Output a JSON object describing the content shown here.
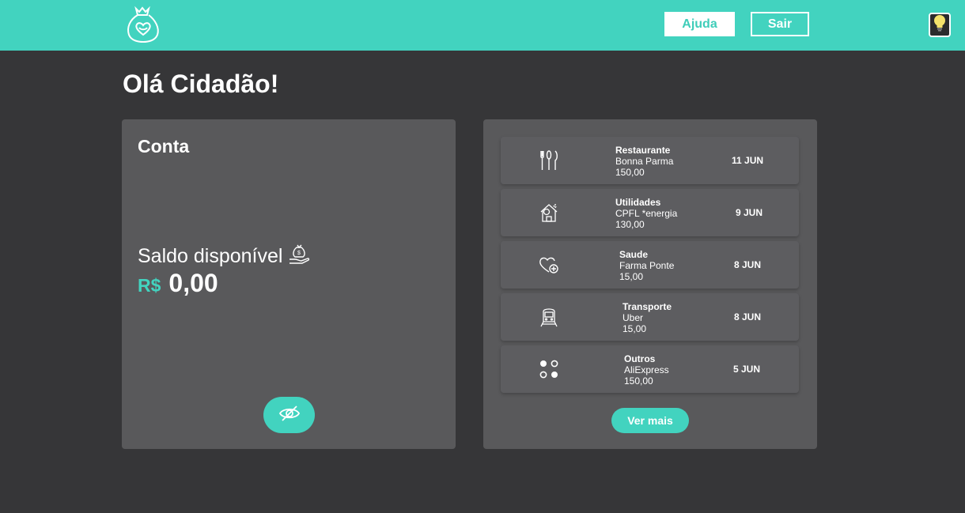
{
  "header": {
    "logo_icon": "money-bag-heart-icon",
    "help_label": "Ajuda",
    "logout_label": "Sair",
    "theme_icon": "lightbulb-icon",
    "accent_color": "#42d3bf"
  },
  "greeting": "Olá Cidadão!",
  "account": {
    "title": "Conta",
    "balance_label": "Saldo disponível",
    "balance_icon": "money-bag-hand-icon",
    "currency": "R$",
    "amount": "0,00",
    "toggle_icon": "eye-slash-icon"
  },
  "transactions": {
    "items": [
      {
        "category": "Restaurante",
        "merchant": "Bonna Parma",
        "value": "150,00",
        "date": "11 JUN",
        "icon": "cutlery-icon"
      },
      {
        "category": "Utilidades",
        "merchant": "CPFL *energia",
        "value": "130,00",
        "date": "9 JUN",
        "icon": "house-utilities-icon"
      },
      {
        "category": "Saude",
        "merchant": "Farma Ponte",
        "value": "15,00",
        "date": "8 JUN",
        "icon": "heart-health-icon"
      },
      {
        "category": "Transporte",
        "merchant": "Uber",
        "value": "15,00",
        "date": "8 JUN",
        "icon": "train-icon"
      },
      {
        "category": "Outros",
        "merchant": "AliExpress",
        "value": "150,00",
        "date": "5 JUN",
        "icon": "dots-icon"
      }
    ],
    "more_label": "Ver mais"
  }
}
